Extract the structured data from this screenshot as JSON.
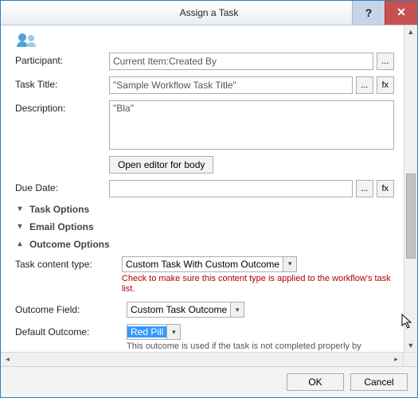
{
  "titlebar": {
    "title": "Assign a Task"
  },
  "labels": {
    "participant": "Participant:",
    "task_title": "Task Title:",
    "description": "Description:",
    "due_date": "Due Date:",
    "task_content_type": "Task content type:",
    "outcome_field": "Outcome Field:",
    "default_outcome": "Default Outcome:"
  },
  "fields": {
    "participant_value": "Current Item:Created By",
    "task_title_value": "\"Sample Workflow Task Title\"",
    "description_value": "\"Bla\"",
    "due_date_value": ""
  },
  "buttons": {
    "ellipsis": "...",
    "fx": "fx",
    "open_editor": "Open editor for body",
    "ok": "OK",
    "cancel": "Cancel"
  },
  "sections": {
    "task_options": "Task Options",
    "email_options": "Email Options",
    "outcome_options": "Outcome Options"
  },
  "outcome": {
    "content_type_value": "Custom Task With Custom Outcome",
    "content_type_note": "Check to make sure this content type is applied to the workflow's task list.",
    "field_value": "Custom Task Outcome",
    "default_value": "Red Pill",
    "default_note": "This outcome is used if the task is not completed properly by"
  }
}
